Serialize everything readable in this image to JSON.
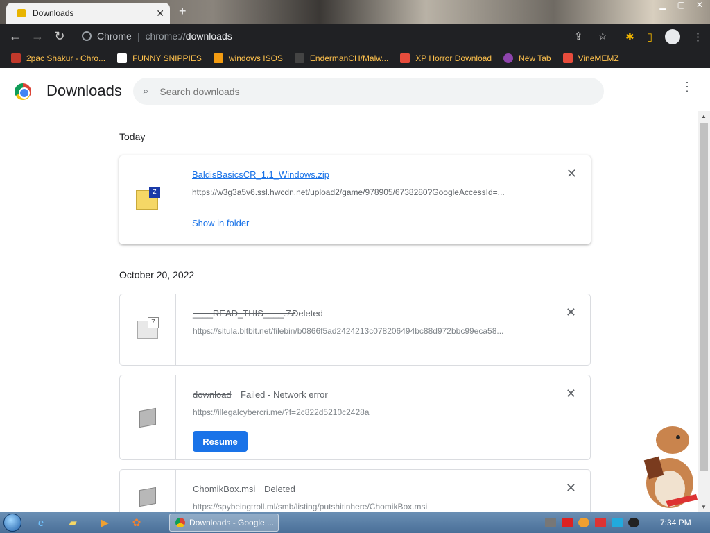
{
  "window": {
    "tab_title": "Downloads",
    "tab_close": "✕",
    "new_tab": "+",
    "controls": [
      "▁",
      "▢",
      "✕"
    ]
  },
  "toolbar": {
    "brand": "Chrome",
    "url_scheme": "chrome://",
    "url_host": "downloads"
  },
  "bookmarks": [
    {
      "label": "2pac Shakur - Chro...",
      "color": "#c0392b"
    },
    {
      "label": "FUNNY SNIPPIES",
      "color": "#ffffff"
    },
    {
      "label": "windows ISOS",
      "color": "#f39c12"
    },
    {
      "label": "EndermanCH/Malw...",
      "color": "#444444"
    },
    {
      "label": "XP Horror Download",
      "color": "#e74c3c"
    },
    {
      "label": "New Tab",
      "color": "#8e44ad"
    },
    {
      "label": "VineMEMZ",
      "color": "#e74c3c"
    }
  ],
  "page": {
    "title": "Downloads",
    "search_placeholder": "Search downloads",
    "menu_icon": "⋮"
  },
  "groups": [
    {
      "date": "Today",
      "items": [
        {
          "filename": "BaldisBasicsCR_1.1_Windows.zip",
          "status": "",
          "url": "https://w3g3a5v6.ssl.hwcdn.net/upload2/game/978905/6738280?GoogleAccessId=...",
          "action": "Show in folder"
        }
      ]
    },
    {
      "date": "October 20, 2022",
      "items": [
        {
          "filename": "____READ_THIS____.7z",
          "status": "Deleted",
          "url": "https://situla.bitbit.net/filebin/b0866f5ad2424213c078206494bc88d972bbc99eca58...",
          "action": ""
        },
        {
          "filename": "download",
          "status": "Failed - Network error",
          "url": "https://illegalcybercri.me/?f=2c822d5210c2428a",
          "action": "Resume"
        },
        {
          "filename": "ChomikBox.msi",
          "status": "Deleted",
          "url": "https://spybeingtroll.ml/smb/listing/putshitinhere/ChomikBox.msi",
          "action": ""
        }
      ]
    }
  ],
  "taskbar": {
    "active_task": "Downloads - Google ...",
    "clock": "7:34 PM"
  },
  "colors": {
    "accent": "#1a73e8",
    "toolbar_bg": "#202124",
    "bookmark_text": "#ffc24d"
  }
}
